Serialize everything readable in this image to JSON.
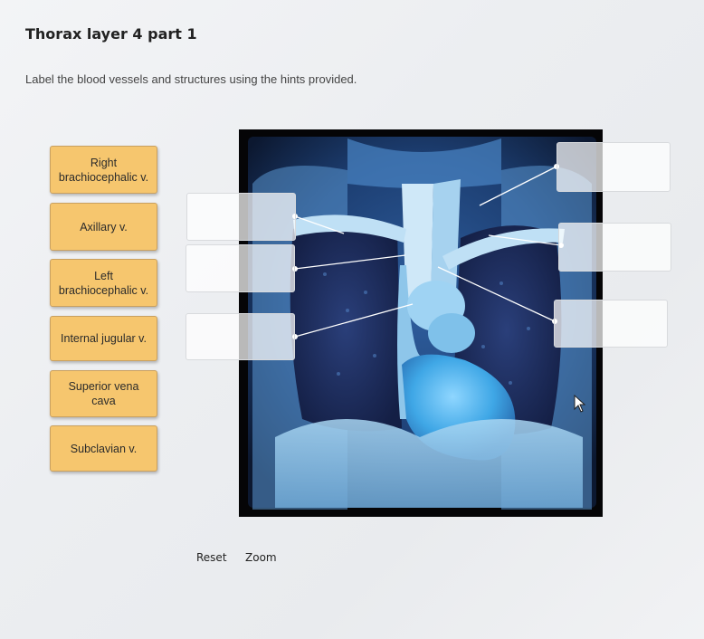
{
  "page": {
    "title": "Thorax layer 4 part 1",
    "instructions": "Label the blood vessels and structures using the hints provided."
  },
  "labels": [
    {
      "text": "Right brachiocephalic v."
    },
    {
      "text": "Axillary v."
    },
    {
      "text": "Left brachiocephalic v."
    },
    {
      "text": "Internal jugular v."
    },
    {
      "text": "Superior vena cava"
    },
    {
      "text": "Subclavian v."
    }
  ],
  "figure": {
    "icon": "thorax-dissection-image"
  },
  "drop_targets": {
    "left": [
      "",
      "",
      ""
    ],
    "right": [
      "",
      "",
      ""
    ]
  },
  "controls": {
    "reset_label": "Reset",
    "zoom_label": "Zoom"
  },
  "colors": {
    "label_fill": "#f6c66e",
    "image_tint": "#3c7fcf"
  }
}
